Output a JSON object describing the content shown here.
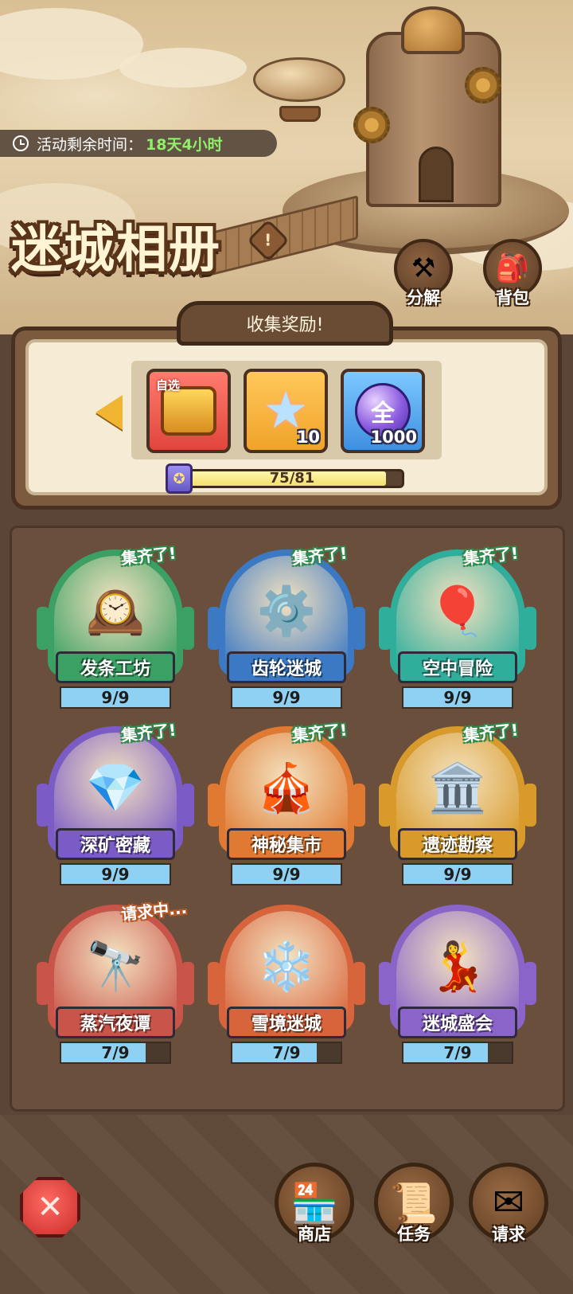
{
  "event": {
    "timer_label": "活动剩余时间：",
    "timer_value": "18天4小时",
    "title": "迷城相册"
  },
  "top_buttons": {
    "decompose": {
      "label": "分解",
      "icon": "hammer-icon"
    },
    "backpack": {
      "label": "背包",
      "icon": "backpack-icon"
    }
  },
  "reward": {
    "header": "收集奖励!",
    "items": [
      {
        "tag": "自选",
        "qty": "",
        "icon": "treasure-chest-icon"
      },
      {
        "tag": "",
        "qty": "10",
        "icon": "rainbow-star-icon"
      },
      {
        "tag": "",
        "qty": "1000",
        "icon": "orb-icon",
        "glyph": "全"
      }
    ],
    "progress_text": "75/81",
    "progress_value": 75,
    "progress_max": 81
  },
  "albums": [
    {
      "name": "发条工坊",
      "count": "9/9",
      "value": 9,
      "max": 9,
      "status": "集齐了!",
      "theme": "#3aa063",
      "emoji": "🕰️"
    },
    {
      "name": "齿轮迷城",
      "count": "9/9",
      "value": 9,
      "max": 9,
      "status": "集齐了!",
      "theme": "#3b79c4",
      "emoji": "⚙️"
    },
    {
      "name": "空中冒险",
      "count": "9/9",
      "value": 9,
      "max": 9,
      "status": "集齐了!",
      "theme": "#2fae9c",
      "emoji": "🎈"
    },
    {
      "name": "深矿密藏",
      "count": "9/9",
      "value": 9,
      "max": 9,
      "status": "集齐了!",
      "theme": "#7b5bc6",
      "emoji": "💎"
    },
    {
      "name": "神秘集市",
      "count": "9/9",
      "value": 9,
      "max": 9,
      "status": "集齐了!",
      "theme": "#e07a32",
      "emoji": "🎪"
    },
    {
      "name": "遗迹勘察",
      "count": "9/9",
      "value": 9,
      "max": 9,
      "status": "集齐了!",
      "theme": "#d89a2a",
      "emoji": "🏛️"
    },
    {
      "name": "蒸汽夜谭",
      "count": "7/9",
      "value": 7,
      "max": 9,
      "status": "请求中...",
      "theme": "#c9554a",
      "emoji": "🔭"
    },
    {
      "name": "雪境迷城",
      "count": "7/9",
      "value": 7,
      "max": 9,
      "status": "",
      "theme": "#d8643c",
      "emoji": "❄️"
    },
    {
      "name": "迷城盛会",
      "count": "7/9",
      "value": 7,
      "max": 9,
      "status": "",
      "theme": "#8a64c9",
      "emoji": "💃"
    }
  ],
  "bottom_nav": {
    "close_icon": "close-icon",
    "shop": {
      "label": "商店",
      "icon": "shop-icon"
    },
    "tasks": {
      "label": "任务",
      "icon": "scroll-icon"
    },
    "request": {
      "label": "请求",
      "icon": "mail-machine-icon"
    }
  }
}
